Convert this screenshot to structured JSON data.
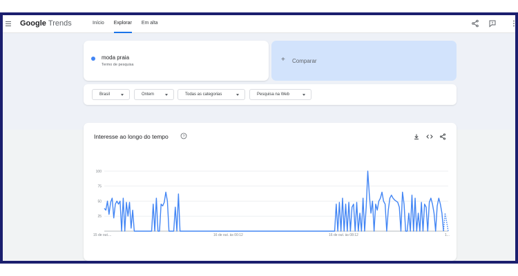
{
  "header": {
    "logo_google": "Google",
    "logo_trends": "Trends",
    "tabs": [
      {
        "label": "Início"
      },
      {
        "label": "Explorar"
      },
      {
        "label": "Em alta"
      }
    ],
    "active_tab": "Explorar",
    "icons": [
      "menu-icon",
      "share-icon",
      "feedback-icon",
      "apps-icon"
    ]
  },
  "search_term": {
    "name": "moda praia",
    "subtitle": "Termo de pesquisa",
    "color": "#4285f4"
  },
  "compare": {
    "label": "Comparar"
  },
  "filters": [
    {
      "label": "Brasil"
    },
    {
      "label": "Ontem"
    },
    {
      "label": "Todas as categorias"
    },
    {
      "label": "Pesquisa na Web"
    }
  ],
  "chart_section": {
    "title": "Interesse ao longo do tempo",
    "icons": [
      "help-icon",
      "download-icon",
      "embed-icon",
      "share-icon"
    ]
  },
  "chart_data": {
    "type": "line",
    "ylim": [
      0,
      100
    ],
    "yticks": [
      25,
      50,
      75,
      100
    ],
    "grid": true,
    "legend": "none",
    "line_color": "#4285f4",
    "xtick_labels": [
      "15 de out....",
      "16 de out. às 00:12",
      "16 de out. às 08:12",
      "1..."
    ],
    "values": [
      38,
      35,
      50,
      28,
      48,
      55,
      22,
      45,
      50,
      45,
      50,
      0,
      55,
      0,
      48,
      25,
      48,
      5,
      35,
      0,
      0,
      0,
      0,
      0,
      0,
      0,
      0,
      0,
      0,
      0,
      0,
      45,
      0,
      55,
      0,
      0,
      45,
      42,
      48,
      65,
      50,
      0,
      0,
      0,
      0,
      40,
      0,
      62,
      0,
      0,
      0,
      0,
      0,
      0,
      0,
      0,
      0,
      0,
      0,
      0,
      0,
      0,
      0,
      0,
      0,
      0,
      0,
      0,
      0,
      0,
      0,
      0,
      0,
      0,
      0,
      0,
      0,
      0,
      0,
      0,
      0,
      0,
      0,
      0,
      0,
      0,
      0,
      0,
      0,
      0,
      0,
      0,
      0,
      0,
      0,
      0,
      0,
      0,
      0,
      0,
      0,
      0,
      0,
      0,
      0,
      0,
      0,
      0,
      0,
      0,
      0,
      0,
      0,
      0,
      0,
      0,
      0,
      0,
      0,
      0,
      0,
      0,
      0,
      0,
      0,
      0,
      0,
      0,
      0,
      0,
      0,
      0,
      0,
      0,
      0,
      0,
      0,
      0,
      0,
      0,
      0,
      0,
      0,
      0,
      0,
      0,
      0,
      45,
      0,
      48,
      0,
      55,
      0,
      45,
      0,
      48,
      0,
      40,
      45,
      0,
      48,
      0,
      30,
      0,
      55,
      0,
      40,
      100,
      60,
      30,
      50,
      0,
      45,
      35,
      50,
      55,
      65,
      50,
      45,
      0,
      35,
      55,
      60,
      55,
      52,
      50,
      48,
      40,
      0,
      65,
      45,
      0,
      0,
      30,
      0,
      60,
      0,
      55,
      0,
      30,
      0,
      48,
      0,
      45,
      40,
      0,
      48,
      55,
      45,
      30,
      0,
      42,
      55,
      45,
      30,
      0
    ],
    "partial_tail": [
      30,
      15,
      0
    ]
  }
}
